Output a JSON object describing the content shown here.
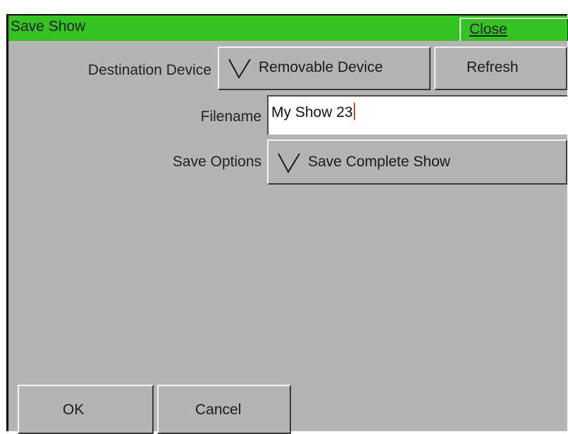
{
  "dialog": {
    "title": "Save Show",
    "close_label": "Close"
  },
  "form": {
    "destination_label": "Destination Device",
    "destination_value": "Removable Device",
    "refresh_label": "Refresh",
    "filename_label": "Filename",
    "filename_value": "My Show 23",
    "save_options_label": "Save Options",
    "save_options_value": "Save Complete Show"
  },
  "footer": {
    "ok_label": "OK",
    "cancel_label": "Cancel"
  },
  "colors": {
    "titlebar": "#33c421",
    "panel": "#b4b4b4",
    "input_bg": "#ffffff"
  },
  "icons": {
    "dropdown": "chevron-down-icon"
  }
}
